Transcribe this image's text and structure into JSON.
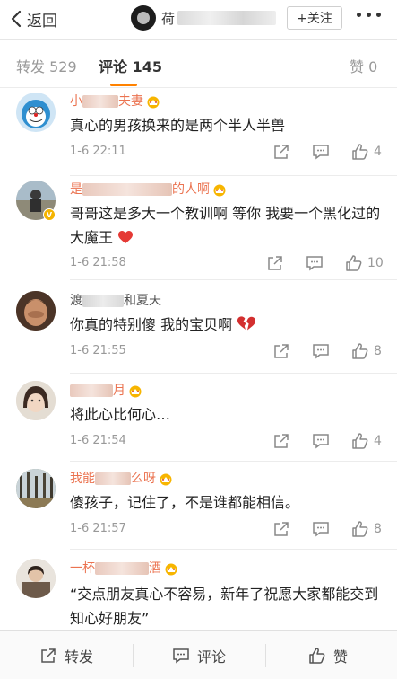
{
  "nav": {
    "back_label": "返回",
    "account_name": "荷",
    "follow_label": "+关注"
  },
  "tabs": {
    "repost": "转发 529",
    "comment": "评论 145",
    "like": "赞 0"
  },
  "comments": [
    {
      "username_start": "小",
      "username_end": "夫妻",
      "text": "真心的男孩换来的是两个半人半兽",
      "time": "1-6 22:11",
      "likes": "4"
    },
    {
      "username_start": "是",
      "username_end": "的人啊",
      "text": "哥哥这是多大一个教训啊 等你 我要一个黑化过的大魔王",
      "time": "1-6 21:58",
      "likes": "10"
    },
    {
      "username_start": "渡",
      "username_end": "和夏天",
      "text": "你真的特别傻 我的宝贝啊",
      "time": "1-6 21:55",
      "likes": "8"
    },
    {
      "username_start": "",
      "username_end": "月",
      "text": "将此心比何心…",
      "time": "1-6 21:54",
      "likes": "4"
    },
    {
      "username_start": "我能",
      "username_end": "么呀",
      "text": "傻孩子，记住了，不是谁都能相信。",
      "time": "1-6 21:57",
      "likes": "8"
    },
    {
      "username_start": "一杯",
      "username_end": "酒",
      "text": "“交点朋友真心不容易，新年了祝愿大家都能交到知心好朋友”",
      "time": "",
      "likes": ""
    }
  ],
  "bottom": {
    "repost": "转发",
    "comment": "评论",
    "like": "赞"
  },
  "colors": {
    "accent": "#ff8200",
    "username": "#eb7350",
    "meta": "#999999"
  }
}
